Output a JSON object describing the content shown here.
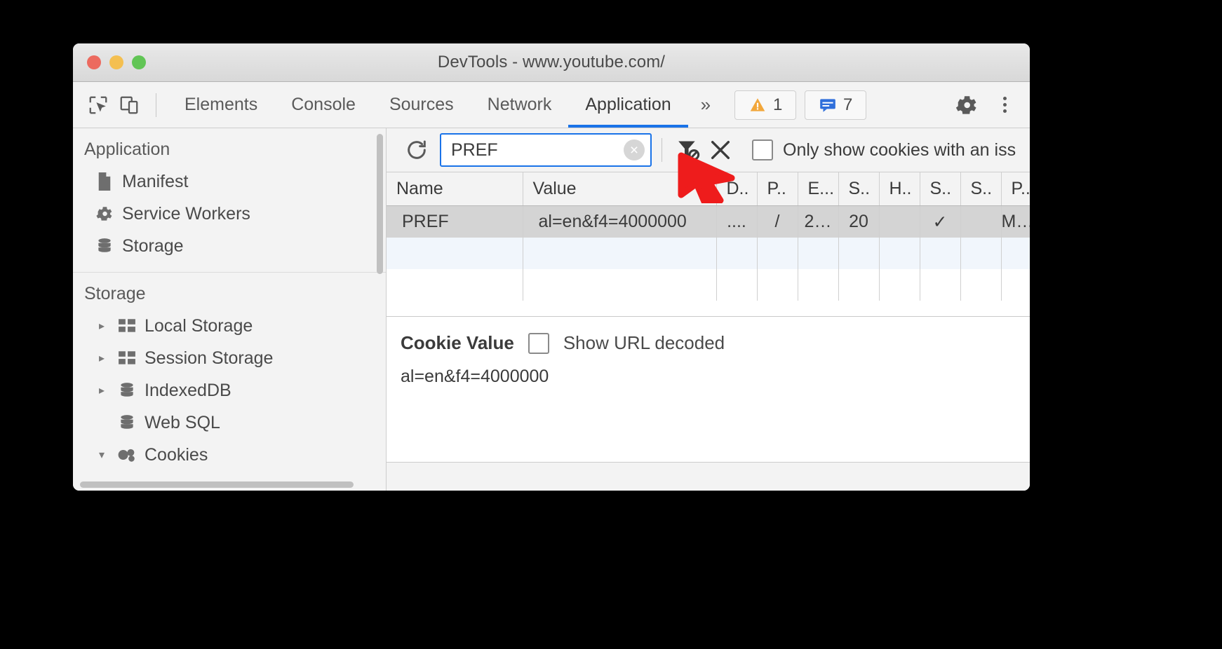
{
  "window": {
    "title": "DevTools - www.youtube.com/",
    "traffic_lights": [
      "close",
      "minimize",
      "zoom"
    ]
  },
  "tabstrip": {
    "icons": [
      {
        "name": "inspect-element-icon",
        "label": "Inspect element"
      },
      {
        "name": "device-toolbar-icon",
        "label": "Toggle device toolbar"
      }
    ],
    "tabs": [
      {
        "label": "Elements",
        "active": false
      },
      {
        "label": "Console",
        "active": false
      },
      {
        "label": "Sources",
        "active": false
      },
      {
        "label": "Network",
        "active": false
      },
      {
        "label": "Application",
        "active": true
      }
    ],
    "more_label": "»",
    "badges": [
      {
        "name": "warning-badge",
        "count": "1",
        "color": "#f2a73b"
      },
      {
        "name": "message-badge",
        "count": "7",
        "color": "#2f6fdb"
      }
    ],
    "settings_label": "Settings",
    "more_options_label": "Customize and control DevTools"
  },
  "sidebar": {
    "sections": [
      {
        "title": "Application",
        "items": [
          {
            "label": "Manifest",
            "icon": "document-icon",
            "twisty": false,
            "expanded": false
          },
          {
            "label": "Service Workers",
            "icon": "gear-icon",
            "twisty": false,
            "expanded": false
          },
          {
            "label": "Storage",
            "icon": "database-icon",
            "twisty": false,
            "expanded": false
          }
        ]
      },
      {
        "title": "Storage",
        "items": [
          {
            "label": "Local Storage",
            "icon": "table-icon",
            "twisty": true,
            "expanded": false
          },
          {
            "label": "Session Storage",
            "icon": "table-icon",
            "twisty": true,
            "expanded": false
          },
          {
            "label": "IndexedDB",
            "icon": "database-icon",
            "twisty": true,
            "expanded": false
          },
          {
            "label": "Web SQL",
            "icon": "database-icon",
            "twisty": false,
            "expanded": false
          },
          {
            "label": "Cookies",
            "icon": "cookie-icon",
            "twisty": true,
            "expanded": true
          }
        ]
      }
    ]
  },
  "toolbar": {
    "refresh_label": "Refresh",
    "filter": {
      "value": "PREF",
      "placeholder": "Filter",
      "clear_label": "×"
    },
    "clear_filter_label": "Clear filtered cookies",
    "clear_all_label": "Clear all cookies",
    "issues_checkbox": {
      "label": "Only show cookies with an iss",
      "checked": false
    }
  },
  "table": {
    "columns": [
      "Name",
      "Value",
      "D..",
      "P..",
      "E...",
      "S..",
      "H..",
      "S..",
      "S..",
      "P.."
    ],
    "rows": [
      {
        "selected": true,
        "cells": [
          "PREF",
          "al=en&f4=4000000",
          "....",
          "/",
          "2…",
          "20",
          "",
          "✓",
          "",
          "M…"
        ]
      },
      {
        "selected": false,
        "cells": [
          "",
          "",
          "",
          "",
          "",
          "",
          "",
          "",
          "",
          ""
        ]
      },
      {
        "selected": false,
        "cells": [
          "",
          "",
          "",
          "",
          "",
          "",
          "",
          "",
          "",
          ""
        ]
      }
    ]
  },
  "preview": {
    "title": "Cookie Value",
    "decoded_label": "Show URL decoded",
    "decoded_checked": false,
    "value": "al=en&f4=4000000"
  },
  "annotation": {
    "cursor_color": "#ee1c1c",
    "cursor_name": "red-arrow-pointer"
  }
}
